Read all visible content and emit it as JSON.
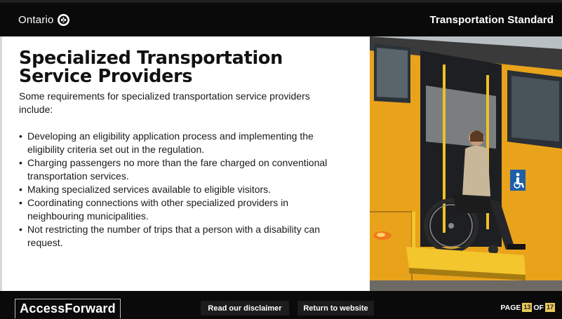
{
  "header": {
    "brand": "Ontario",
    "brand_icon": "trillium-icon",
    "module_title": "Transportation Standard"
  },
  "main": {
    "title_line1": "Specialized Transportation",
    "title_line2": "Service Providers",
    "intro": "Some requirements for specialized transportation service providers include:",
    "bullets": [
      "Developing an eligibility application process and implementing the eligibility criteria set out in the regulation.",
      "Charging passengers no more than the fare charged on conventional transportation services.",
      "Making specialized services available to eligible visitors.",
      "Coordinating connections with other specialized providers in neighbouring municipalities.",
      "Not restricting the number of trips that a person with a disability can request."
    ],
    "photo_icon": "accessibility-symbol-icon"
  },
  "footer": {
    "logo": "AccessForward",
    "disclaimer_label": "Read our disclaimer",
    "return_label": "Return to website",
    "page_label": "PAGE",
    "page_current": "13",
    "page_of": "OF",
    "page_total": "17"
  },
  "colors": {
    "bar": "#0a0a0a",
    "bus_yellow": "#e8a21a",
    "page_badge": "#e8c85b"
  }
}
